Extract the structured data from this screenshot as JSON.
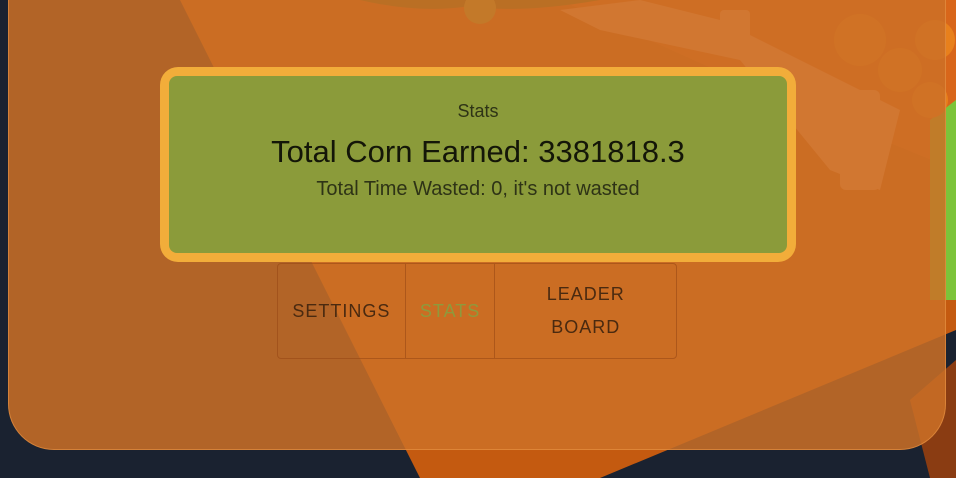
{
  "colors": {
    "panel": "#cc7026",
    "card_border": "#f2ad3a",
    "card_fill": "#8b9b3a",
    "active_tab": "#8e9a3c",
    "page_background": "#1a2230"
  },
  "stats": {
    "heading": "Stats",
    "total_corn": "Total Corn Earned: 3381818.3",
    "total_time": "Total Time Wasted: 0, it's not wasted"
  },
  "tabs": {
    "settings": "SETTINGS",
    "stats": "STATS",
    "leaderboard": "LEADER BOARD"
  },
  "active_tab": "stats",
  "icons": [
    "corn-plant-icon",
    "fence-decoration",
    "pumpkin-decoration",
    "grass-decoration"
  ]
}
